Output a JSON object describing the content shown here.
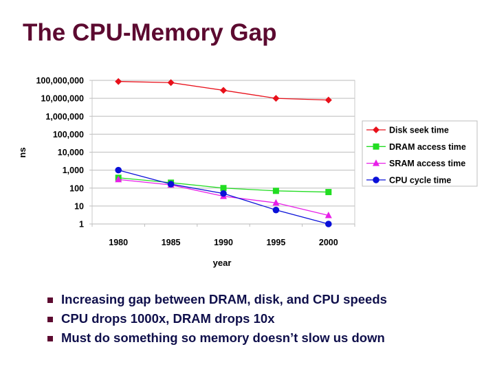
{
  "slide": {
    "title": "The CPU-Memory Gap",
    "bullets": [
      "Increasing gap between DRAM, disk, and CPU speeds",
      "CPU drops 1000x, DRAM drops 10x",
      "Must do something so memory doesn’t slow us down"
    ],
    "colors": {
      "title": "#5c0a30",
      "bullet_text": "#0f0f4b",
      "bullet_marker": "#5c0a30"
    }
  },
  "chart_data": {
    "type": "line",
    "title": "",
    "xlabel": "year",
    "ylabel": "ns",
    "yscale": "log",
    "ylim": [
      1,
      100000000
    ],
    "grid": true,
    "legend_position": "right",
    "categories": [
      "1980",
      "1985",
      "1990",
      "1995",
      "2000"
    ],
    "yticks": [
      {
        "value": 100000000,
        "label": "100,000,000"
      },
      {
        "value": 10000000,
        "label": "10,000,000"
      },
      {
        "value": 1000000,
        "label": "1,000,000"
      },
      {
        "value": 100000,
        "label": "100,000"
      },
      {
        "value": 10000,
        "label": "10,000"
      },
      {
        "value": 1000,
        "label": "1,000"
      },
      {
        "value": 100,
        "label": "100"
      },
      {
        "value": 10,
        "label": "10"
      },
      {
        "value": 1,
        "label": "1"
      }
    ],
    "series": [
      {
        "name": "Disk seek time",
        "color": "#e8101a",
        "marker": "diamond",
        "values": [
          87000000,
          75000000,
          28000000,
          10000000,
          8000000
        ]
      },
      {
        "name": "DRAM access time",
        "color": "#22dd22",
        "marker": "square",
        "values": [
          375,
          200,
          100,
          70,
          60
        ]
      },
      {
        "name": "SRAM access time",
        "color": "#e81ee8",
        "marker": "triangle",
        "values": [
          300,
          150,
          35,
          15,
          3
        ]
      },
      {
        "name": "CPU cycle time",
        "color": "#0a10d8",
        "marker": "circle",
        "values": [
          1000,
          166,
          50,
          6,
          1
        ]
      }
    ]
  }
}
